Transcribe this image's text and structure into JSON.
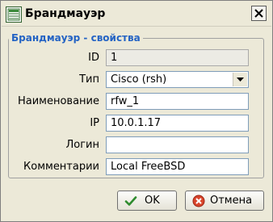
{
  "window": {
    "title": "Брандмауэр",
    "app_icon": "grid-window-icon",
    "close_icon": "close-icon"
  },
  "group": {
    "title": "Брандмауэр - свойства"
  },
  "fields": {
    "id": {
      "label": "ID",
      "value": "1"
    },
    "type": {
      "label": "Тип",
      "value": "Cisco (rsh)"
    },
    "name": {
      "label": "Наименование",
      "value": "rfw_1"
    },
    "ip": {
      "label": "IP",
      "value": "10.0.1.17"
    },
    "login": {
      "label": "Логин",
      "value": ""
    },
    "comment": {
      "label": "Комментарии",
      "value": "Local FreeBSD"
    }
  },
  "buttons": {
    "ok_label": "OK",
    "ok_icon": "checkmark-icon",
    "cancel_label": "Отмена",
    "cancel_icon": "cancel-icon"
  },
  "colors": {
    "group_title": "#2463c4",
    "window_bg": "#ece9d8"
  }
}
